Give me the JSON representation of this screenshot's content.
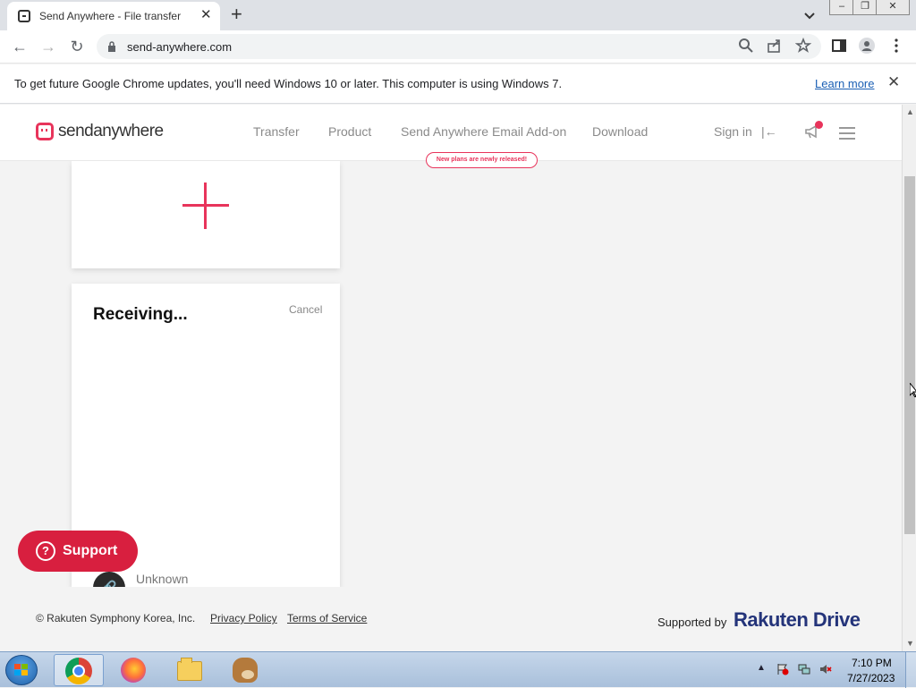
{
  "browser": {
    "tab_title": "Send Anywhere - File transfer",
    "new_tab_label": "+",
    "url": "send-anywhere.com",
    "infobar_message": "To get future Google Chrome updates, you'll need Windows 10 or later. This computer is using Windows 7.",
    "infobar_link": "Learn more"
  },
  "site": {
    "logo_text": "sendanywhere",
    "nav": [
      "Transfer",
      "Product",
      "Send Anywhere Email Add-on",
      "Download"
    ],
    "new_plans_badge": "New plans are newly released!",
    "sign_in": "Sign in",
    "receiving_title": "Receiving...",
    "cancel_label": "Cancel",
    "file_name": "Unknown",
    "support_label": "Support",
    "footer": {
      "copyright": "© Rakuten Symphony Korea, Inc.",
      "privacy": "Privacy Policy",
      "terms": "Terms of Service",
      "supported_by": "Supported by",
      "brand": "Rakuten Drive"
    },
    "accent_color": "#e8345b"
  },
  "taskbar": {
    "time": "7:10 PM",
    "date": "7/27/2023",
    "apps": [
      "chrome-icon",
      "firefox-icon",
      "file-explorer-icon",
      "emule-icon"
    ]
  }
}
